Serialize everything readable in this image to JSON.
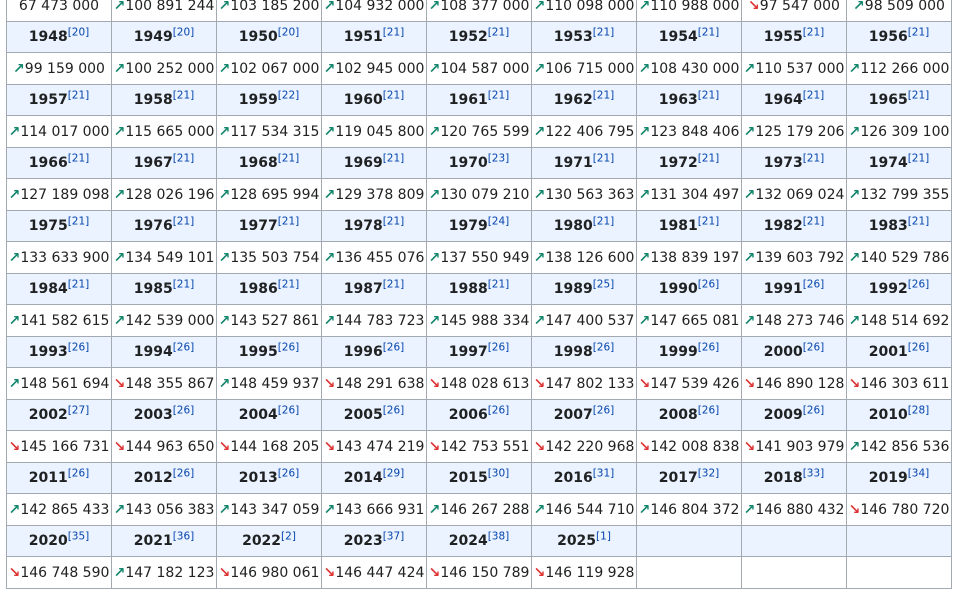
{
  "rows": [
    {
      "years": [],
      "values": [
        {
          "v": "67 473 000",
          "t": ""
        },
        {
          "v": "100 891 244",
          "t": "up"
        },
        {
          "v": "103 185 200",
          "t": "up"
        },
        {
          "v": "104 932 000",
          "t": "up"
        },
        {
          "v": "108 377 000",
          "t": "up"
        },
        {
          "v": "110 098 000",
          "t": "up"
        },
        {
          "v": "110 988 000",
          "t": "up"
        },
        {
          "v": "97 547 000",
          "t": "down"
        },
        {
          "v": "98 509 000",
          "t": "up"
        }
      ]
    },
    {
      "years": [
        {
          "y": "1948",
          "r": "[20]"
        },
        {
          "y": "1949",
          "r": "[20]"
        },
        {
          "y": "1950",
          "r": "[20]"
        },
        {
          "y": "1951",
          "r": "[21]"
        },
        {
          "y": "1952",
          "r": "[21]"
        },
        {
          "y": "1953",
          "r": "[21]"
        },
        {
          "y": "1954",
          "r": "[21]"
        },
        {
          "y": "1955",
          "r": "[21]"
        },
        {
          "y": "1956",
          "r": "[21]"
        }
      ],
      "values": [
        {
          "v": "99 159 000",
          "t": "up"
        },
        {
          "v": "100 252 000",
          "t": "up"
        },
        {
          "v": "102 067 000",
          "t": "up"
        },
        {
          "v": "102 945 000",
          "t": "up"
        },
        {
          "v": "104 587 000",
          "t": "up"
        },
        {
          "v": "106 715 000",
          "t": "up"
        },
        {
          "v": "108 430 000",
          "t": "up"
        },
        {
          "v": "110 537 000",
          "t": "up"
        },
        {
          "v": "112 266 000",
          "t": "up"
        }
      ]
    },
    {
      "years": [
        {
          "y": "1957",
          "r": "[21]"
        },
        {
          "y": "1958",
          "r": "[21]"
        },
        {
          "y": "1959",
          "r": "[22]"
        },
        {
          "y": "1960",
          "r": "[21]"
        },
        {
          "y": "1961",
          "r": "[21]"
        },
        {
          "y": "1962",
          "r": "[21]"
        },
        {
          "y": "1963",
          "r": "[21]"
        },
        {
          "y": "1964",
          "r": "[21]"
        },
        {
          "y": "1965",
          "r": "[21]"
        }
      ],
      "values": [
        {
          "v": "114 017 000",
          "t": "up"
        },
        {
          "v": "115 665 000",
          "t": "up"
        },
        {
          "v": "117 534 315",
          "t": "up"
        },
        {
          "v": "119 045 800",
          "t": "up"
        },
        {
          "v": "120 765 599",
          "t": "up"
        },
        {
          "v": "122 406 795",
          "t": "up"
        },
        {
          "v": "123 848 406",
          "t": "up"
        },
        {
          "v": "125 179 206",
          "t": "up"
        },
        {
          "v": "126 309 100",
          "t": "up"
        }
      ]
    },
    {
      "years": [
        {
          "y": "1966",
          "r": "[21]"
        },
        {
          "y": "1967",
          "r": "[21]"
        },
        {
          "y": "1968",
          "r": "[21]"
        },
        {
          "y": "1969",
          "r": "[21]"
        },
        {
          "y": "1970",
          "r": "[23]"
        },
        {
          "y": "1971",
          "r": "[21]"
        },
        {
          "y": "1972",
          "r": "[21]"
        },
        {
          "y": "1973",
          "r": "[21]"
        },
        {
          "y": "1974",
          "r": "[21]"
        }
      ],
      "values": [
        {
          "v": "127 189 098",
          "t": "up"
        },
        {
          "v": "128 026 196",
          "t": "up"
        },
        {
          "v": "128 695 994",
          "t": "up"
        },
        {
          "v": "129 378 809",
          "t": "up"
        },
        {
          "v": "130 079 210",
          "t": "up"
        },
        {
          "v": "130 563 363",
          "t": "up"
        },
        {
          "v": "131 304 497",
          "t": "up"
        },
        {
          "v": "132 069 024",
          "t": "up"
        },
        {
          "v": "132 799 355",
          "t": "up"
        }
      ]
    },
    {
      "years": [
        {
          "y": "1975",
          "r": "[21]"
        },
        {
          "y": "1976",
          "r": "[21]"
        },
        {
          "y": "1977",
          "r": "[21]"
        },
        {
          "y": "1978",
          "r": "[21]"
        },
        {
          "y": "1979",
          "r": "[24]"
        },
        {
          "y": "1980",
          "r": "[21]"
        },
        {
          "y": "1981",
          "r": "[21]"
        },
        {
          "y": "1982",
          "r": "[21]"
        },
        {
          "y": "1983",
          "r": "[21]"
        }
      ],
      "values": [
        {
          "v": "133 633 900",
          "t": "up"
        },
        {
          "v": "134 549 101",
          "t": "up"
        },
        {
          "v": "135 503 754",
          "t": "up"
        },
        {
          "v": "136 455 076",
          "t": "up"
        },
        {
          "v": "137 550 949",
          "t": "up"
        },
        {
          "v": "138 126 600",
          "t": "up"
        },
        {
          "v": "138 839 197",
          "t": "up"
        },
        {
          "v": "139 603 792",
          "t": "up"
        },
        {
          "v": "140 529 786",
          "t": "up"
        }
      ]
    },
    {
      "years": [
        {
          "y": "1984",
          "r": "[21]"
        },
        {
          "y": "1985",
          "r": "[21]"
        },
        {
          "y": "1986",
          "r": "[21]"
        },
        {
          "y": "1987",
          "r": "[21]"
        },
        {
          "y": "1988",
          "r": "[21]"
        },
        {
          "y": "1989",
          "r": "[25]"
        },
        {
          "y": "1990",
          "r": "[26]"
        },
        {
          "y": "1991",
          "r": "[26]"
        },
        {
          "y": "1992",
          "r": "[26]"
        }
      ],
      "values": [
        {
          "v": "141 582 615",
          "t": "up"
        },
        {
          "v": "142 539 000",
          "t": "up"
        },
        {
          "v": "143 527 861",
          "t": "up"
        },
        {
          "v": "144 783 723",
          "t": "up"
        },
        {
          "v": "145 988 334",
          "t": "up"
        },
        {
          "v": "147 400 537",
          "t": "up"
        },
        {
          "v": "147 665 081",
          "t": "up"
        },
        {
          "v": "148 273 746",
          "t": "up"
        },
        {
          "v": "148 514 692",
          "t": "up"
        }
      ]
    },
    {
      "years": [
        {
          "y": "1993",
          "r": "[26]"
        },
        {
          "y": "1994",
          "r": "[26]"
        },
        {
          "y": "1995",
          "r": "[26]"
        },
        {
          "y": "1996",
          "r": "[26]"
        },
        {
          "y": "1997",
          "r": "[26]"
        },
        {
          "y": "1998",
          "r": "[26]"
        },
        {
          "y": "1999",
          "r": "[26]"
        },
        {
          "y": "2000",
          "r": "[26]"
        },
        {
          "y": "2001",
          "r": "[26]"
        }
      ],
      "values": [
        {
          "v": "148 561 694",
          "t": "up"
        },
        {
          "v": "148 355 867",
          "t": "down"
        },
        {
          "v": "148 459 937",
          "t": "up"
        },
        {
          "v": "148 291 638",
          "t": "down"
        },
        {
          "v": "148 028 613",
          "t": "down"
        },
        {
          "v": "147 802 133",
          "t": "down"
        },
        {
          "v": "147 539 426",
          "t": "down"
        },
        {
          "v": "146 890 128",
          "t": "down"
        },
        {
          "v": "146 303 611",
          "t": "down"
        }
      ]
    },
    {
      "years": [
        {
          "y": "2002",
          "r": "[27]"
        },
        {
          "y": "2003",
          "r": "[26]"
        },
        {
          "y": "2004",
          "r": "[26]"
        },
        {
          "y": "2005",
          "r": "[26]"
        },
        {
          "y": "2006",
          "r": "[26]"
        },
        {
          "y": "2007",
          "r": "[26]"
        },
        {
          "y": "2008",
          "r": "[26]"
        },
        {
          "y": "2009",
          "r": "[26]"
        },
        {
          "y": "2010",
          "r": "[28]"
        }
      ],
      "values": [
        {
          "v": "145 166 731",
          "t": "down"
        },
        {
          "v": "144 963 650",
          "t": "down"
        },
        {
          "v": "144 168 205",
          "t": "down"
        },
        {
          "v": "143 474 219",
          "t": "down"
        },
        {
          "v": "142 753 551",
          "t": "down"
        },
        {
          "v": "142 220 968",
          "t": "down"
        },
        {
          "v": "142 008 838",
          "t": "down"
        },
        {
          "v": "141 903 979",
          "t": "down"
        },
        {
          "v": "142 856 536",
          "t": "up"
        }
      ]
    },
    {
      "years": [
        {
          "y": "2011",
          "r": "[26]"
        },
        {
          "y": "2012",
          "r": "[26]"
        },
        {
          "y": "2013",
          "r": "[26]"
        },
        {
          "y": "2014",
          "r": "[29]"
        },
        {
          "y": "2015",
          "r": "[30]"
        },
        {
          "y": "2016",
          "r": "[31]"
        },
        {
          "y": "2017",
          "r": "[32]"
        },
        {
          "y": "2018",
          "r": "[33]"
        },
        {
          "y": "2019",
          "r": "[34]"
        }
      ],
      "values": [
        {
          "v": "142 865 433",
          "t": "up"
        },
        {
          "v": "143 056 383",
          "t": "up"
        },
        {
          "v": "143 347 059",
          "t": "up"
        },
        {
          "v": "143 666 931",
          "t": "up"
        },
        {
          "v": "146 267 288",
          "t": "up"
        },
        {
          "v": "146 544 710",
          "t": "up"
        },
        {
          "v": "146 804 372",
          "t": "up"
        },
        {
          "v": "146 880 432",
          "t": "up"
        },
        {
          "v": "146 780 720",
          "t": "down"
        }
      ]
    },
    {
      "years": [
        {
          "y": "2020",
          "r": "[35]"
        },
        {
          "y": "2021",
          "r": "[36]"
        },
        {
          "y": "2022",
          "r": "[2]"
        },
        {
          "y": "2023",
          "r": "[37]"
        },
        {
          "y": "2024",
          "r": "[38]"
        },
        {
          "y": "2025",
          "r": "[1]"
        },
        {
          "y": "",
          "r": ""
        },
        {
          "y": "",
          "r": ""
        },
        {
          "y": "",
          "r": ""
        }
      ],
      "values": [
        {
          "v": "146 748 590",
          "t": "down"
        },
        {
          "v": "147 182 123",
          "t": "up"
        },
        {
          "v": "146 980 061",
          "t": "down"
        },
        {
          "v": "146 447 424",
          "t": "down"
        },
        {
          "v": "146 150 789",
          "t": "down"
        },
        {
          "v": "146 119 928",
          "t": "down"
        },
        {
          "v": "",
          "t": ""
        },
        {
          "v": "",
          "t": ""
        },
        {
          "v": "",
          "t": ""
        }
      ]
    }
  ],
  "icons": {
    "up": "trend-up-arrow-icon",
    "down": "trend-down-arrow-icon"
  },
  "glyphs": {
    "up": "↗",
    "down": "↘"
  },
  "colors": {
    "up": "#14866d",
    "down": "#d33333",
    "year_bg": "#eaf3ff",
    "ref_link": "#0645ad",
    "border": "#a2a9b1"
  }
}
